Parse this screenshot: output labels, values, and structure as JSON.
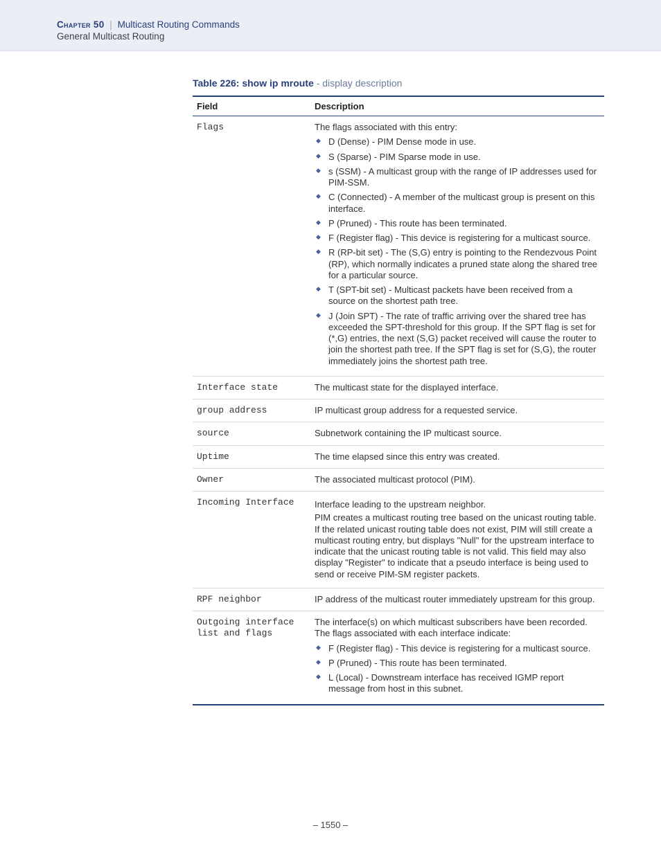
{
  "header": {
    "chapter_label": "Chapter 50",
    "pipe": "|",
    "chapter_title": "Multicast Routing Commands",
    "section_title": "General Multicast Routing"
  },
  "caption": {
    "bold": "Table 226: show ip mroute",
    "light": " - display description"
  },
  "columns": {
    "field": "Field",
    "description": "Description"
  },
  "rows": {
    "flags": {
      "field": "Flags",
      "lead": "The flags associated with this entry:",
      "items": [
        "D (Dense) - PIM Dense mode in use.",
        "S (Sparse) - PIM Sparse mode in use.",
        "s (SSM) - A multicast group with the range of IP addresses used for PIM-SSM.",
        "C (Connected) - A member of the multicast group is present on this interface.",
        "P (Pruned) - This route has been terminated.",
        "F (Register flag) - This device is registering for a multicast source.",
        "R (RP-bit set) - The (S,G) entry is pointing to the Rendezvous Point (RP), which normally indicates a pruned state along the shared tree for a particular source.",
        "T (SPT-bit set) - Multicast packets have been received from a source on the shortest path tree.",
        "J (Join SPT) - The rate of traffic arriving over the shared tree has exceeded the SPT-threshold for this group. If the SPT flag is set for (*,G) entries, the next (S,G) packet received will cause the router to join the shortest path tree. If the SPT flag is set for (S,G), the router immediately joins the shortest path tree."
      ]
    },
    "interface_state": {
      "field": "Interface state",
      "desc": "The multicast state for the displayed interface."
    },
    "group_address": {
      "field": "group address",
      "desc": "IP multicast group address for a requested service."
    },
    "source": {
      "field": "source",
      "desc": "Subnetwork containing the IP multicast source."
    },
    "uptime": {
      "field": "Uptime",
      "desc": "The time elapsed since this entry was created."
    },
    "owner": {
      "field": "Owner",
      "desc": "The associated multicast protocol (PIM)."
    },
    "incoming_interface": {
      "field": "Incoming Interface",
      "p1": "Interface leading to the upstream neighbor.",
      "p2": "PIM creates a multicast routing tree based on the unicast routing table. If the related unicast routing table does not exist, PIM will still create a multicast routing entry, but displays \"Null\" for the upstream interface to indicate that the unicast routing table is not valid. This field may also display \"Register\" to indicate that a pseudo interface is being used to send or receive PIM-SM register packets."
    },
    "rpf_neighbor": {
      "field": "RPF neighbor",
      "desc": "IP address of the multicast router immediately upstream for this group."
    },
    "outgoing": {
      "field": "Outgoing interface\nlist and flags",
      "lead": "The interface(s) on which multicast subscribers have been recorded. The flags associated with each interface indicate:",
      "items": [
        "F (Register flag) - This device is registering for a multicast source.",
        "P (Pruned) - This route has been terminated.",
        "L (Local) - Downstream interface has received IGMP report message from host in this subnet."
      ]
    }
  },
  "footer": {
    "page": "–  1550  –"
  }
}
